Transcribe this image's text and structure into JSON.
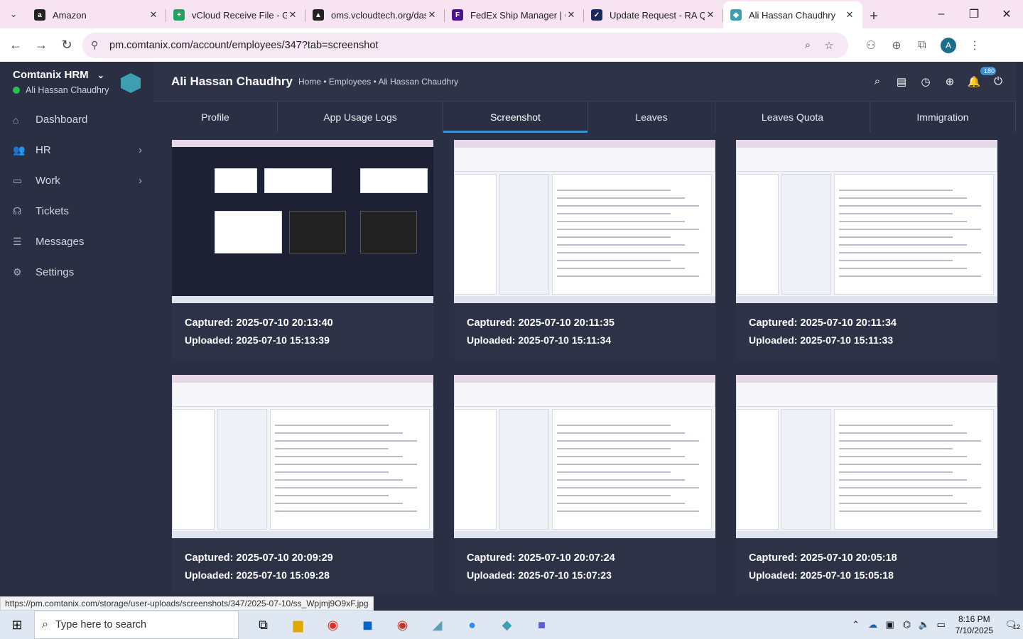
{
  "browser": {
    "tabs": [
      {
        "title": "Amazon",
        "favicon": "a",
        "color": "#222222"
      },
      {
        "title": "vCloud Receive File - Go",
        "favicon": "+",
        "color": "#1fa463"
      },
      {
        "title": "oms.vcloudtech.org/das",
        "favicon": "▲",
        "color": "#222222"
      },
      {
        "title": "FedEx Ship Manager | C",
        "favicon": "F",
        "color": "#4d148c"
      },
      {
        "title": "Update Request - RA Q",
        "favicon": "✓",
        "color": "#1b2a5a"
      },
      {
        "title": "Ali Hassan Chaudhry",
        "favicon": "◆",
        "color": "#3f9fb2"
      }
    ],
    "url": "pm.comtanix.com/account/employees/347?tab=screenshot",
    "avatar_letter": "A",
    "status_url": "https://pm.comtanix.com/storage/user-uploads/screenshots/347/2025-07-10/ss_Wpjmj9O9xF.jpg"
  },
  "sidebar": {
    "brand": "Comtanix HRM",
    "user": "Ali Hassan Chaudhry",
    "items": [
      {
        "label": "Dashboard",
        "icon": "⌂"
      },
      {
        "label": "HR",
        "icon": "👥",
        "chevron": "›"
      },
      {
        "label": "Work",
        "icon": "▭",
        "chevron": "›"
      },
      {
        "label": "Tickets",
        "icon": "☊"
      },
      {
        "label": "Messages",
        "icon": "☰"
      },
      {
        "label": "Settings",
        "icon": "⚙"
      }
    ]
  },
  "header": {
    "title": "Ali Hassan Chaudhry",
    "breadcrumb": "Home • Employees • Ali Hassan Chaudhry",
    "notification_count": "180"
  },
  "tabs": [
    "Profile",
    "App Usage Logs",
    "Screenshot",
    "Leaves",
    "Leaves Quota",
    "Immigration"
  ],
  "screenshots": [
    {
      "captured": "Captured: 2025-07-10 20:13:40",
      "uploaded": "Uploaded: 2025-07-10 15:13:39",
      "dark": true
    },
    {
      "captured": "Captured: 2025-07-10 20:11:35",
      "uploaded": "Uploaded: 2025-07-10 15:11:34"
    },
    {
      "captured": "Captured: 2025-07-10 20:11:34",
      "uploaded": "Uploaded: 2025-07-10 15:11:33"
    },
    {
      "captured": "Captured: 2025-07-10 20:09:29",
      "uploaded": "Uploaded: 2025-07-10 15:09:28"
    },
    {
      "captured": "Captured: 2025-07-10 20:07:24",
      "uploaded": "Uploaded: 2025-07-10 15:07:23"
    },
    {
      "captured": "Captured: 2025-07-10 20:05:18",
      "uploaded": "Uploaded: 2025-07-10 15:05:18"
    }
  ],
  "taskbar": {
    "search_placeholder": "Type here to search",
    "time": "8:16 PM",
    "date": "7/10/2025",
    "notifications": "12"
  }
}
